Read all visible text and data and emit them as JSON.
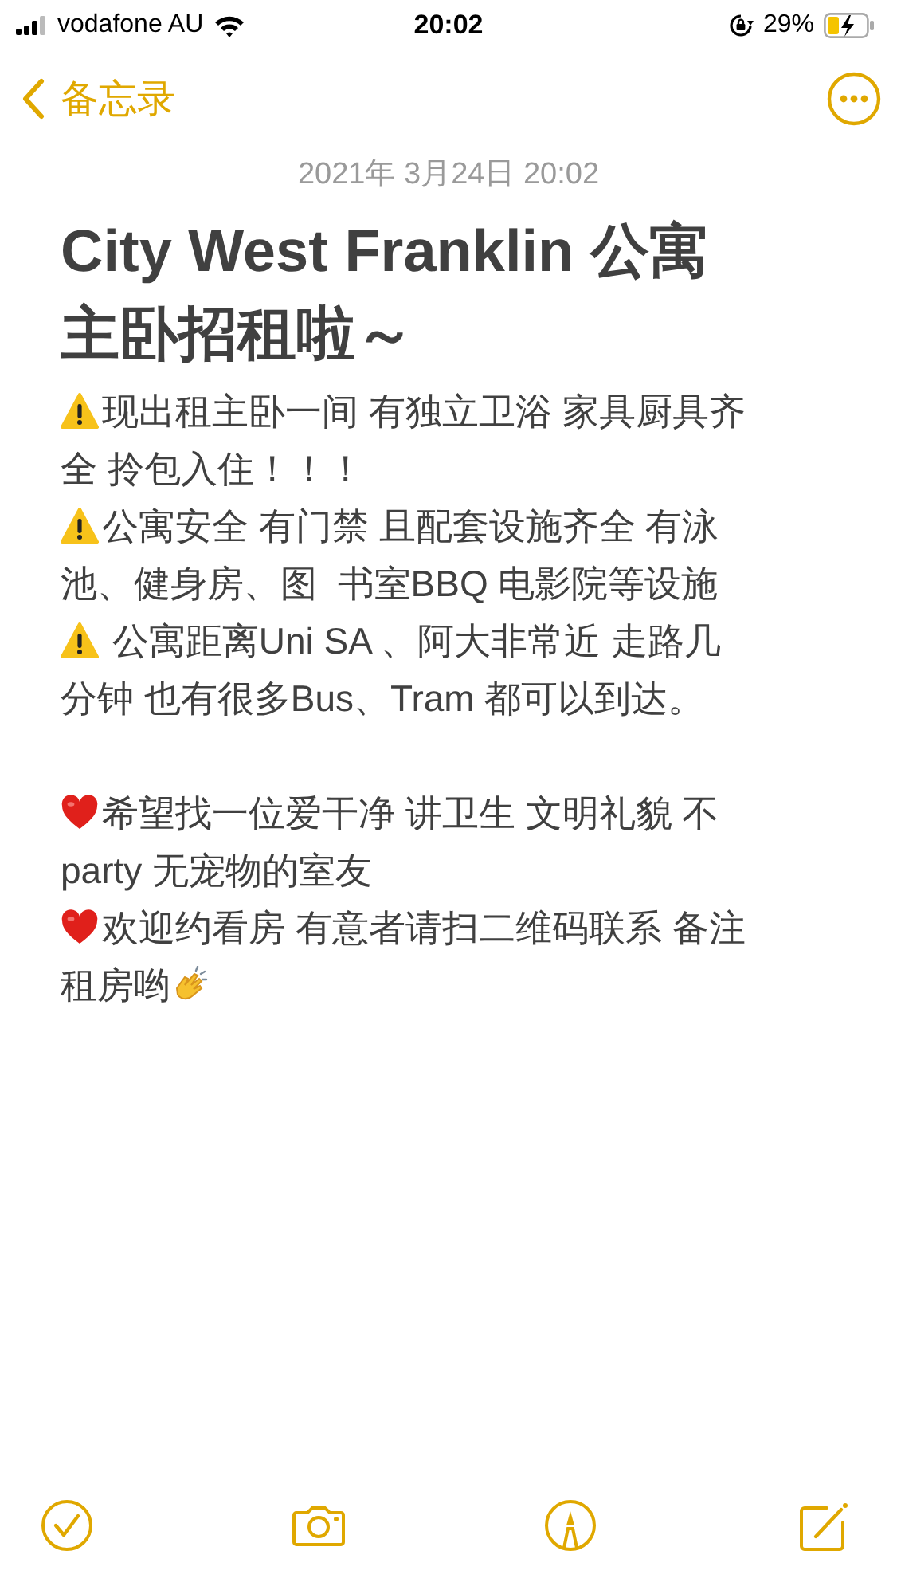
{
  "status_bar": {
    "carrier": "vodafone AU",
    "time": "20:02",
    "battery": "29%"
  },
  "nav": {
    "back_label": "备忘录"
  },
  "note": {
    "date": "2021年 3月24日 20:02",
    "title_lines": [
      "City West Franklin 公寓",
      "主卧招租啦～"
    ],
    "sections": [
      {
        "paragraphs": [
          {
            "kind": "warning",
            "lines": [
              "现出租主卧一间 有独立卫浴 家具厨具齐",
              "全 拎包入住！！！"
            ]
          },
          {
            "kind": "warning",
            "lines": [
              "公寓安全 有门禁 且配套设施齐全 有泳",
              "池、健身房、图  书室BBQ 电影院等设施"
            ]
          },
          {
            "kind": "warning",
            "lines": [
              " 公寓距离Uni SA 、阿大非常近 走路几",
              "分钟 也有很多Bus、Tram 都可以到达。"
            ]
          }
        ]
      },
      {
        "paragraphs": [
          {
            "kind": "heart",
            "lines": [
              "希望找一位爱干净 讲卫生 文明礼貌 不",
              "party 无宠物的室友"
            ]
          },
          {
            "kind": "heartclap",
            "lines": [
              "欢迎约看房 有意者请扫二维码联系 备注",
              "租房哟"
            ]
          }
        ]
      }
    ]
  },
  "toolbar": [
    {
      "kind": "checklist"
    },
    {
      "kind": "camera"
    },
    {
      "kind": "markup"
    },
    {
      "kind": "compose"
    }
  ]
}
